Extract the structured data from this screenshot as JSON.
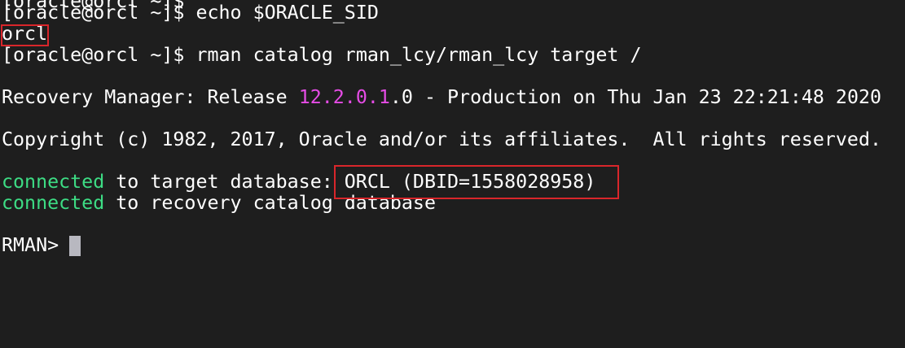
{
  "terminal": {
    "partial_top_line": "[oracle@orcl ~]$ ",
    "prompt": "[oracle@orcl ~]$ ",
    "cmd1": "echo $ORACLE_SID",
    "out1": "orcl",
    "cmd2": "rman catalog rman_lcy/rman_lcy target /",
    "banner_prefix": "Recovery Manager: Release ",
    "banner_version": "12.2.0.1",
    "banner_suffix": ".0 - Production on Thu Jan 23 22:21:48 2020",
    "copyright": "Copyright (c) 1982, 2017, Oracle and/or its affiliates.  All rights reserved.",
    "connected_word": "connected",
    "target_text": " to target database: ",
    "target_db": "ORCL (DBID=1558028958)",
    "catalog_text": " to recovery catalog database",
    "rman_prompt": "RMAN> "
  },
  "colors": {
    "background": "#1e1e1e",
    "text": "#ffffff",
    "version_magenta": "#e64ce6",
    "connected_green": "#3ddc84",
    "highlight_red": "#d9262b",
    "cursor": "#b8b8c0"
  }
}
